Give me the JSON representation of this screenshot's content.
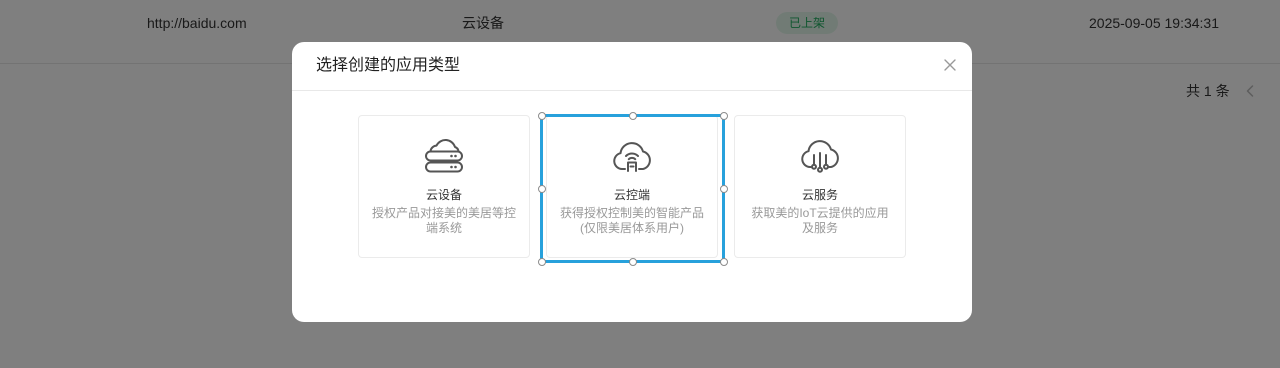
{
  "page": {
    "table_row": {
      "url": "http://baidu.com",
      "app_type": "云设备",
      "status": "已上架",
      "created_at": "2025-09-05 19:34:31"
    },
    "pagination": {
      "total": "共 1 条",
      "prev_icon": "chevron-left-icon"
    }
  },
  "modal": {
    "title": "选择创建的应用类型",
    "close_icon": "close-icon",
    "options": [
      {
        "icon": "cloud-server-icon",
        "label": "云设备",
        "description_lines": [
          "授权产品对接美的美居等控",
          "端系统"
        ],
        "selected": false
      },
      {
        "icon": "cloud-wifi-icon",
        "label": "云控端",
        "description_lines": [
          "获得授权控制美的智能产品",
          "(仅限美居体系用户)"
        ],
        "selected": true
      },
      {
        "icon": "cloud-circuit-icon",
        "label": "云服务",
        "description_lines": [
          "获取美的IoT云提供的应用",
          "及服务"
        ],
        "selected": false
      }
    ]
  },
  "colors": {
    "selection": "#27a1dc",
    "status_text": "#1fad5e",
    "status_bg": "#e3f7eb",
    "icon_stroke": "#555555",
    "card_border": "#ebebeb"
  }
}
